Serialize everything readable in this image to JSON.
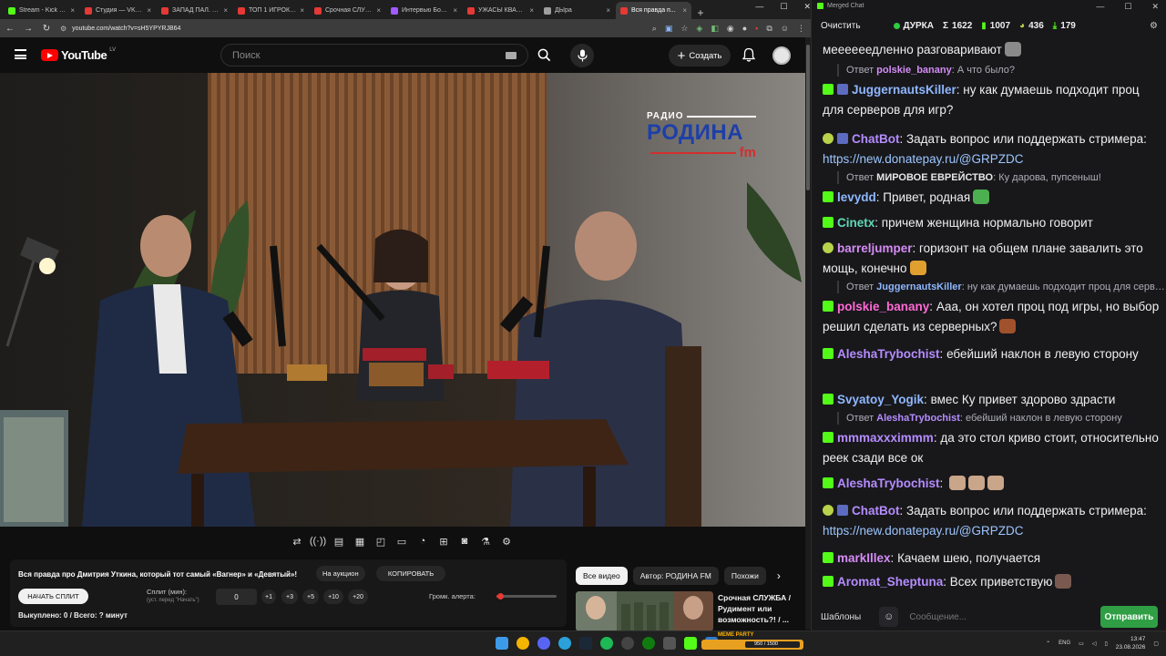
{
  "browser": {
    "tabs": [
      {
        "label": "Stream - Kick Dash",
        "color": "#53fc18",
        "active": false
      },
      {
        "label": "Студия — VK Видео",
        "color": "#e53935",
        "active": false
      },
      {
        "label": "ЗАПАД ПАЛ. АСИ...",
        "color": "#e53935",
        "active": false
      },
      {
        "label": "ТОП 1 ИГРОК ГЕ...",
        "color": "#e53935",
        "active": false
      },
      {
        "label": "Срочная СЛУЖБА",
        "color": "#e53935",
        "active": false
      },
      {
        "label": "Интервью Больш...",
        "color": "#a259ff",
        "active": false
      },
      {
        "label": "УЖАСЫ КВАРТИР...",
        "color": "#e53935",
        "active": false
      },
      {
        "label": "ДЫра",
        "color": "#9e9e9e",
        "active": false
      },
      {
        "label": "Вся правда п...",
        "color": "#e53935",
        "active": true
      }
    ],
    "url": "youtube.com/watch?v=sH5YPYRJB64"
  },
  "youtube": {
    "logo_text": "YouTube",
    "country_code": "LV",
    "search_placeholder": "Поиск",
    "create_label": "Создать",
    "channel_watermark": {
      "top": "РАДИО",
      "main": "РОДИНА",
      "suffix": "fm"
    },
    "video_title": "Вся правда про Дмитрия Уткина, который тот самый «Вагнер» и «Девятый»!",
    "auction_label": "На аукцион",
    "copy_label": "КОПИРОВАТЬ",
    "start_split_label": "НАЧАТЬ СПЛИТ",
    "split_label": "Сплит (мин):",
    "split_sub": "(уст. перед \"Начать\")",
    "split_value": "0",
    "steps": [
      "+1",
      "+3",
      "+5",
      "+10",
      "+20"
    ],
    "alert_volume_label": "Громк. алерта:",
    "alert_volume": 0.02,
    "bought_text": "Выкуплено: 0 / Всего: ? минут",
    "chips": [
      {
        "label": "Все видео",
        "active": true
      },
      {
        "label": "Автор: РОДИНА FM",
        "active": false
      },
      {
        "label": "Похожи",
        "active": false
      }
    ],
    "recommended": {
      "title": "Срочная СЛУЖБА / Рудимент или возможность?! / ..."
    }
  },
  "chat": {
    "window_title": "Merged Chat",
    "clear_label": "Очистить",
    "channel": "ДУРКА",
    "stats": [
      {
        "icon": "sigma",
        "value": "1622"
      },
      {
        "icon": "kick",
        "value": "1007"
      },
      {
        "icon": "vk",
        "value": "436"
      },
      {
        "icon": "download",
        "value": "179"
      }
    ],
    "messages": [
      {
        "type": "text",
        "badge": "",
        "user": "",
        "color": "",
        "text": "меееееедленно разговаривают",
        "emote": "#8a8a8a"
      },
      {
        "type": "reply",
        "user": "polskie_banany",
        "color": "#d58cf5",
        "text": "А что было?"
      },
      {
        "type": "msg",
        "badge": "kick",
        "mod": true,
        "user": "JuggernautsKiller",
        "color": "#8fb7ff",
        "text": "ну как думаешь подходит проц для серверов для игр?"
      },
      {
        "type": "msg",
        "badge": "vk",
        "mod": true,
        "user": "ChatBot",
        "color": "#b58cff",
        "text": "Задать вопрос или поддержать стримера:",
        "link": "https://new.donatepay.ru/@GRPZDC"
      },
      {
        "type": "reply",
        "user": "МИРОВОЕ ЕВРЕЙСТВО",
        "color": "#e7e7e7",
        "text": "Ку дарова, пупсеныш!"
      },
      {
        "type": "msg",
        "badge": "kick",
        "user": "levydd",
        "color": "#8fb7ff",
        "text": "Привет, родная",
        "emote": "#4caf50"
      },
      {
        "type": "msg",
        "badge": "kick",
        "user": "Cinetx",
        "color": "#5fd9b5",
        "text": "причем женщина нормально говорит"
      },
      {
        "type": "msg",
        "badge": "vk",
        "user": "barreljumper",
        "color": "#d58cf5",
        "text": "горизонт на общем плане завалить это мощь, конечно",
        "emote": "#e0a030"
      },
      {
        "type": "reply",
        "user": "JuggernautsKiller",
        "color": "#8fb7ff",
        "text": "ну как думаешь подходит проц для серверов для игр?"
      },
      {
        "type": "msg",
        "badge": "kick",
        "user": "polskie_banany",
        "color": "#ff6ad5",
        "text": "Ааа, он хотел проц под игры, но выбор решил сделать из серверных?",
        "emote": "#a0522d"
      },
      {
        "type": "msg",
        "badge": "kick",
        "user": "AleshaTrybochist",
        "color": "#b58cff",
        "text": "ебейший наклон в левую сторону"
      },
      {
        "type": "msg",
        "badge": "kick",
        "user": "Svyatoy_Yogik",
        "color": "#8fb7ff",
        "text": "вмес Ку привет здорово здрасти"
      },
      {
        "type": "reply",
        "user": "AleshaTrybochist",
        "color": "#b58cff",
        "text": "ебейший наклон в левую сторону"
      },
      {
        "type": "msg",
        "badge": "kick",
        "user": "mmmaxxximmm",
        "color": "#b58cff",
        "text": "да это стол криво стоит, относительно реек сзади все ок"
      },
      {
        "type": "msg",
        "badge": "kick",
        "user": "AleshaTrybochist",
        "color": "#b58cff",
        "text": "",
        "emotes": 3
      },
      {
        "type": "msg",
        "badge": "vk",
        "mod": true,
        "user": "ChatBot",
        "color": "#b58cff",
        "text": "Задать вопрос или поддержать стримера:",
        "link": "https://new.donatepay.ru/@GRPZDC"
      },
      {
        "type": "msg",
        "badge": "kick",
        "user": "markIllex",
        "color": "#d58cf5",
        "text": "Качаем шею, получается"
      },
      {
        "type": "msg",
        "badge": "kick",
        "user": "Aromat_Sheptuna",
        "color": "#b58cff",
        "text": "Всех приветствую",
        "emote": "#7a5a50"
      }
    ],
    "templates_label": "Шаблоны",
    "input_placeholder": "Сообщение...",
    "send_label": "Отправить"
  },
  "taskbar": {
    "meme_label": "MEME PARTY",
    "meme_progress": "950 / 1500",
    "lang": "ENG",
    "time": "13:47",
    "date": "23.08.2026"
  }
}
